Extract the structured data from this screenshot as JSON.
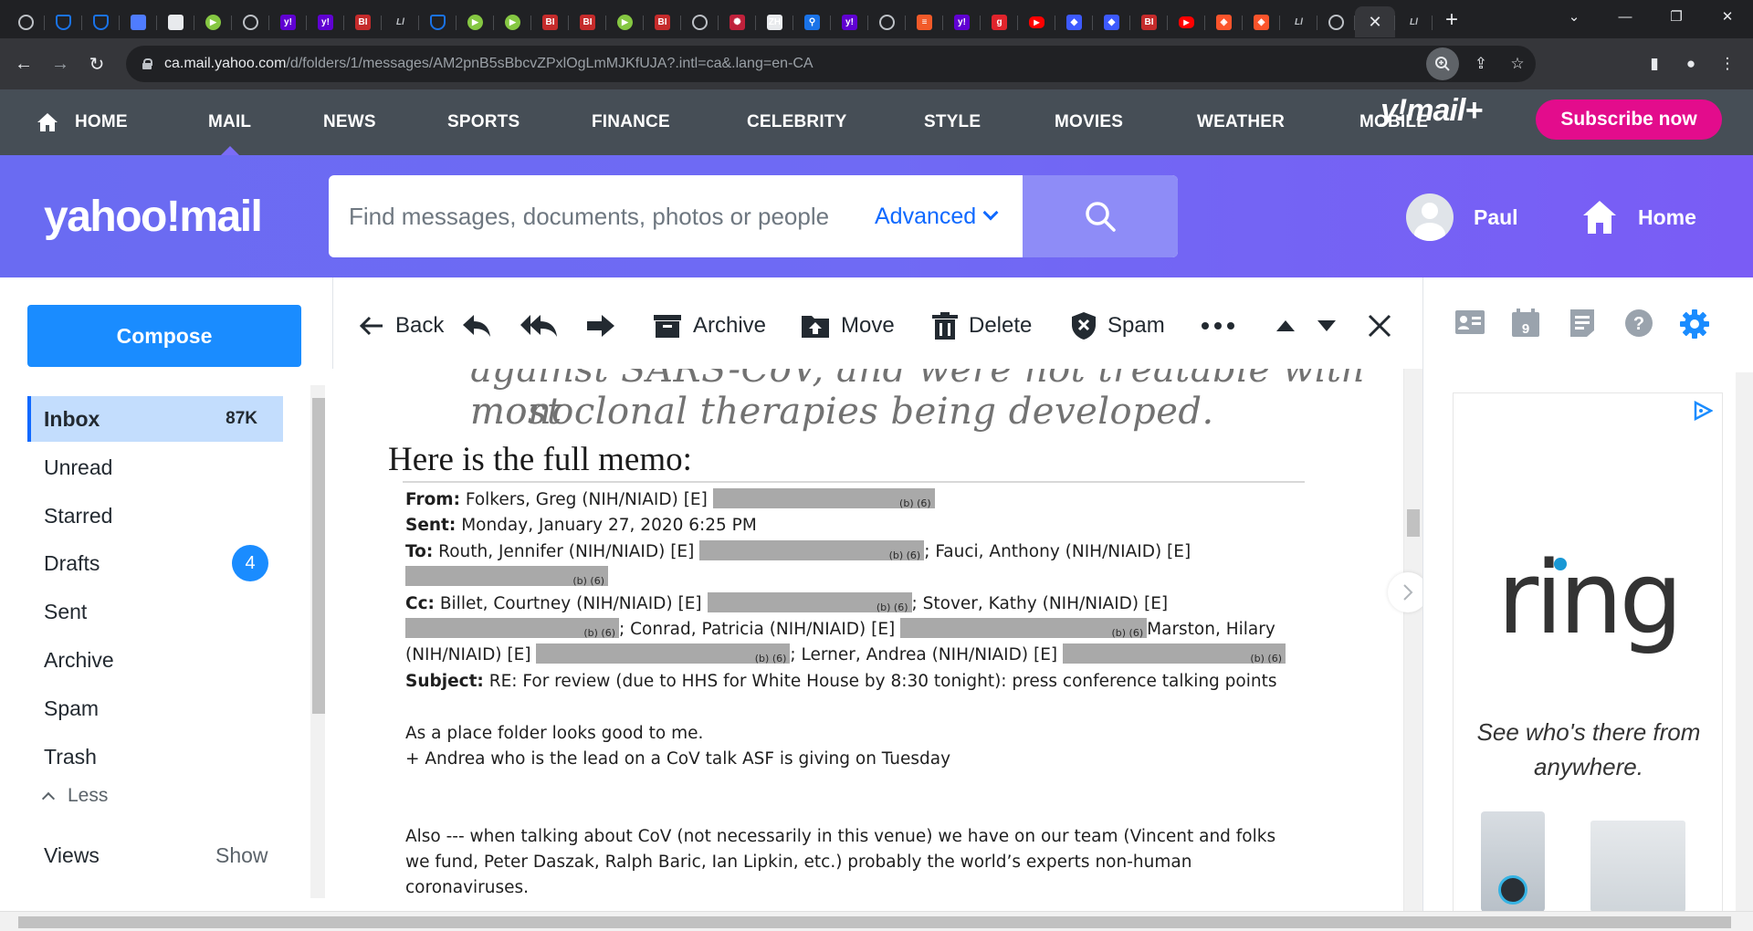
{
  "browser": {
    "tabs": [
      {
        "icon": "chrome-globe-icon",
        "color": "#5f6368",
        "glyph": ""
      },
      {
        "icon": "shield-blue-icon",
        "color": "#1a73e8",
        "glyph": ""
      },
      {
        "icon": "shield-blue-icon",
        "color": "#1a73e8",
        "glyph": ""
      },
      {
        "icon": "bookmark-blue-icon",
        "color": "#4f7cff",
        "glyph": ""
      },
      {
        "icon": "grid-icon",
        "color": "#e8eaed",
        "glyph": ""
      },
      {
        "icon": "rumble-play-icon",
        "color": "#85c742",
        "glyph": "▶"
      },
      {
        "icon": "chrome-globe-icon",
        "color": "#5f6368",
        "glyph": ""
      },
      {
        "icon": "yahoo-icon",
        "color": "#6001d2",
        "glyph": "y!"
      },
      {
        "icon": "yahoo-icon",
        "color": "#6001d2",
        "glyph": "y!"
      },
      {
        "icon": "bi-icon",
        "color": "#c52b2b",
        "glyph": "BI"
      },
      {
        "icon": "ll-icon",
        "color": "#202124",
        "glyph": "Ll"
      },
      {
        "icon": "shield-blue-icon",
        "color": "#1a73e8",
        "glyph": ""
      },
      {
        "icon": "rumble-play-icon",
        "color": "#85c742",
        "glyph": "▶"
      },
      {
        "icon": "rumble-play-icon",
        "color": "#85c742",
        "glyph": "▶"
      },
      {
        "icon": "bi-icon",
        "color": "#c52b2b",
        "glyph": "BI"
      },
      {
        "icon": "bi-icon",
        "color": "#c52b2b",
        "glyph": "BI"
      },
      {
        "icon": "rumble-play-icon",
        "color": "#85c742",
        "glyph": "▶"
      },
      {
        "icon": "bi-icon",
        "color": "#c52b2b",
        "glyph": "BI"
      },
      {
        "icon": "chrome-globe-icon",
        "color": "#5f6368",
        "glyph": ""
      },
      {
        "icon": "starburst-icon",
        "color": "#c0213b",
        "glyph": "✺"
      },
      {
        "icon": "zh-icon",
        "color": "#e8eaed",
        "glyph": "ZH"
      },
      {
        "icon": "search-blue-icon",
        "color": "#1a73e8",
        "glyph": "⚲"
      },
      {
        "icon": "yahoo-icon",
        "color": "#6001d2",
        "glyph": "y!"
      },
      {
        "icon": "chrome-globe-icon",
        "color": "#5f6368",
        "glyph": ""
      },
      {
        "icon": "bars-orange-icon",
        "color": "#f25a29",
        "glyph": "≡"
      },
      {
        "icon": "yahoo-icon",
        "color": "#6001d2",
        "glyph": "y!"
      },
      {
        "icon": "gettr-icon",
        "color": "#e0242c",
        "glyph": "g"
      },
      {
        "icon": "youtube-icon",
        "color": "#ff0000",
        "glyph": "▶"
      },
      {
        "icon": "cube-icon",
        "color": "#3d5afe",
        "glyph": "◆"
      },
      {
        "icon": "cube-icon",
        "color": "#3d5afe",
        "glyph": "◆"
      },
      {
        "icon": "bi-icon",
        "color": "#c52b2b",
        "glyph": "BI"
      },
      {
        "icon": "youtube-icon",
        "color": "#ff0000",
        "glyph": "▶"
      },
      {
        "icon": "brave-icon",
        "color": "#fb542b",
        "glyph": "◈"
      },
      {
        "icon": "brave-icon",
        "color": "#fb542b",
        "glyph": "◈"
      },
      {
        "icon": "ll-icon",
        "color": "#202124",
        "glyph": "Ll"
      },
      {
        "icon": "chrome-globe-icon",
        "color": "#5f6368",
        "glyph": ""
      },
      {
        "icon": "close-icon",
        "color": "#35363a",
        "glyph": "✕",
        "active": true
      },
      {
        "icon": "ll-icon",
        "color": "#202124",
        "glyph": "Ll"
      }
    ],
    "new_tab_label": "+",
    "url_host": "ca.mail.yahoo.com",
    "url_path": "/d/folders/1/messages/AM2pnB5sBbcvZPxlOgLmMJKfUJA?.intl=ca&.lang=en-CA"
  },
  "ynav": {
    "items": [
      {
        "label": "HOME",
        "active": false
      },
      {
        "label": "MAIL",
        "active": true
      },
      {
        "label": "NEWS",
        "active": false
      },
      {
        "label": "SPORTS",
        "active": false
      },
      {
        "label": "FINANCE",
        "active": false
      },
      {
        "label": "CELEBRITY",
        "active": false
      },
      {
        "label": "STYLE",
        "active": false
      },
      {
        "label": "MOVIES",
        "active": false
      },
      {
        "label": "WEATHER",
        "active": false
      },
      {
        "label": "MOBILE",
        "active": false
      }
    ],
    "mail_plus": "y!mail+",
    "subscribe": "Subscribe now"
  },
  "header": {
    "logo": "yahoo!mail",
    "search_placeholder": "Find messages, documents, photos or people",
    "advanced": "Advanced",
    "user_name": "Paul",
    "home": "Home"
  },
  "sidebar": {
    "compose": "Compose",
    "folders": [
      {
        "label": "Inbox",
        "count": "87K",
        "active": true
      },
      {
        "label": "Unread"
      },
      {
        "label": "Starred"
      },
      {
        "label": "Drafts",
        "badge": "4"
      },
      {
        "label": "Sent"
      },
      {
        "label": "Archive"
      },
      {
        "label": "Spam"
      },
      {
        "label": "Trash"
      }
    ],
    "less": "Less",
    "views": "Views",
    "views_show": "Show"
  },
  "toolbar": {
    "back": "Back",
    "archive": "Archive",
    "move": "Move",
    "delete": "Delete",
    "spam": "Spam"
  },
  "message": {
    "italic_line_1": "against SARS-CoV, and were not treatable with most",
    "italic_line_2": "monoclonal therapies being developed.",
    "heading": "Here is the full memo:",
    "memo": {
      "from_label": "From:",
      "from_value": "Folkers, Greg (NIH/NIAID) [E]",
      "sent_label": "Sent:",
      "sent_value": "Monday, January 27, 2020 6:25 PM",
      "to_label": "To:",
      "to_value_1": "Routh, Jennifer (NIH/NIAID) [E]",
      "to_value_2": "; Fauci, Anthony (NIH/NIAID) [E]",
      "cc_label": "Cc:",
      "cc_value_1": "Billet, Courtney (NIH/NIAID) [E]",
      "cc_value_2": "; Stover, Kathy (NIH/NIAID) [E]",
      "cc_value_3": "; Conrad, Patricia (NIH/NIAID) [E]",
      "cc_value_4": "Marston, Hilary",
      "cc_value_5": "(NIH/NIAID) [E]",
      "cc_value_6": "; Lerner, Andrea (NIH/NIAID) [E]",
      "subject_label": "Subject:",
      "subject_value": "RE: For review (due to HHS for White House by 8:30 tonight): press conference talking points",
      "body_1": "As a place folder looks good to me.",
      "body_2": "+ Andrea who is the lead  on a CoV talk ASF is giving on Tuesday",
      "body_3": "Also ---   when  talking about CoV (not necessarily in this venue)  we have on our team (Vincent and folks",
      "body_4": "we fund, Peter Daszak, Ralph Baric, Ian Lipkin, etc.) probably the world’s experts non-human",
      "body_5": "coronaviruses.",
      "redaction_label": "(b) (6)"
    }
  },
  "ad": {
    "brand": "ring",
    "tagline": "See who's there from anywhere.",
    "brand_dot_color": "#1998d5"
  },
  "colors": {
    "nav_bg": "#464e56",
    "header_gradient_start": "#6a6bf2",
    "header_gradient_end": "#7a5cf5",
    "compose": "#1a8cff",
    "subscribe": "#e30c8c",
    "inbox_active": "#c3ddfd"
  }
}
